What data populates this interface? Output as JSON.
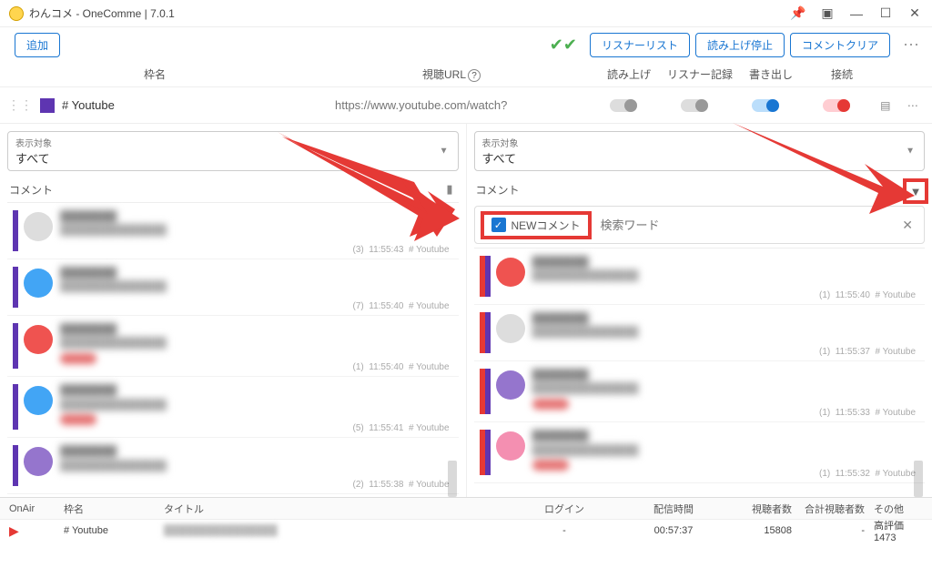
{
  "app": {
    "title": "わんコメ - OneComme | 7.0.1"
  },
  "toolbar": {
    "add": "追加",
    "listener_list": "リスナーリスト",
    "speech_stop": "読み上げ停止",
    "comment_clear": "コメントクリア"
  },
  "columns": {
    "name": "枠名",
    "url": "視聴URL",
    "speech": "読み上げ",
    "listener": "リスナー記録",
    "export": "書き出し",
    "connect": "接続"
  },
  "channel": {
    "name": "# Youtube",
    "url_placeholder": "https://www.youtube.com/watch?"
  },
  "filter": {
    "label": "表示対象",
    "value": "すべて"
  },
  "panel": {
    "comments": "コメント"
  },
  "search": {
    "new_label": "NEWコメント",
    "placeholder": "検索ワード"
  },
  "comments_left": [
    {
      "count": "(3)",
      "time": "11:55:43",
      "source": "# Youtube",
      "avatar": ""
    },
    {
      "count": "(7)",
      "time": "11:55:40",
      "source": "# Youtube",
      "avatar": "c1"
    },
    {
      "count": "(1)",
      "time": "11:55:40",
      "source": "# Youtube",
      "avatar": "c2"
    },
    {
      "count": "(5)",
      "time": "11:55:41",
      "source": "# Youtube",
      "avatar": "c1"
    },
    {
      "count": "(2)",
      "time": "11:55:38",
      "source": "# Youtube",
      "avatar": "c3"
    }
  ],
  "comments_right": [
    {
      "count": "(1)",
      "time": "11:55:40",
      "source": "# Youtube",
      "avatar": "c2"
    },
    {
      "count": "(1)",
      "time": "11:55:37",
      "source": "# Youtube",
      "avatar": ""
    },
    {
      "count": "(1)",
      "time": "11:55:33",
      "source": "# Youtube",
      "avatar": "c3"
    },
    {
      "count": "(1)",
      "time": "11:55:32",
      "source": "# Youtube",
      "avatar": "c4"
    }
  ],
  "bottom": {
    "headers": {
      "onair": "OnAir",
      "name": "枠名",
      "title": "タイトル",
      "login": "ログイン",
      "time": "配信時間",
      "viewers": "視聴者数",
      "total": "合計視聴者数",
      "other": "その他"
    },
    "row": {
      "name": "# Youtube",
      "login": "-",
      "time": "00:57:37",
      "viewers": "15808",
      "total": "-",
      "other": "高評価 1473"
    }
  }
}
